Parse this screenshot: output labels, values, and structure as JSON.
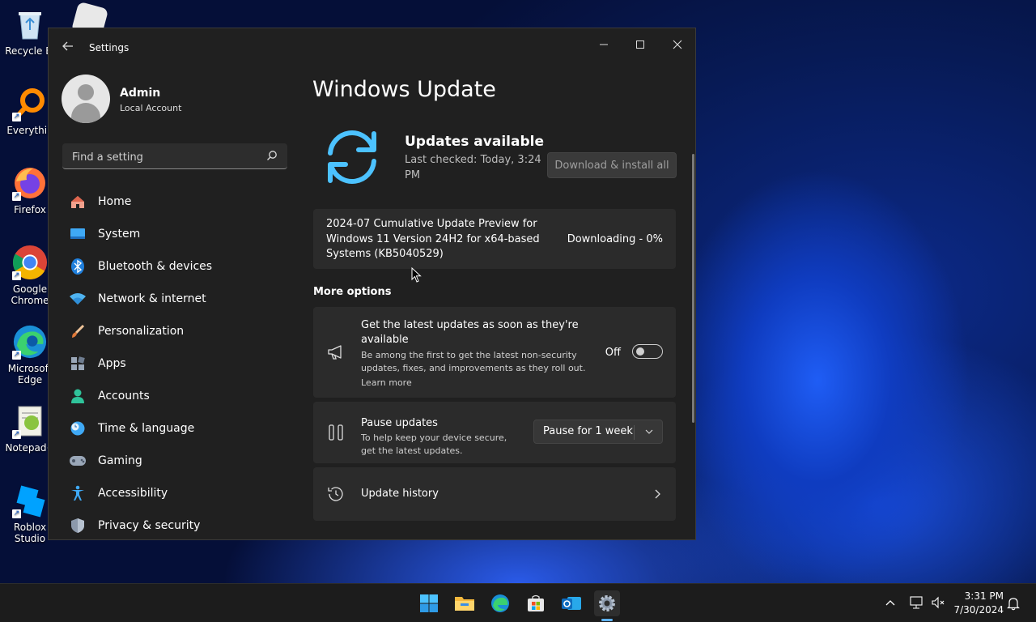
{
  "desktop": {
    "icons": [
      {
        "label": "Recycle Bi",
        "icon": "recycle-bin-icon"
      },
      {
        "label": "Everythin",
        "icon": "everything-search-icon"
      },
      {
        "label": "Firefox",
        "icon": "firefox-icon"
      },
      {
        "label": "Google Chrome",
        "icon": "chrome-icon"
      },
      {
        "label": "Microsoft Edge",
        "icon": "edge-icon"
      },
      {
        "label": "Notepad+",
        "icon": "notepad-plus-icon"
      },
      {
        "label": "Roblox Studio",
        "icon": "roblox-studio-icon"
      }
    ]
  },
  "window": {
    "title": "Settings",
    "controls": [
      "minimize",
      "maximize",
      "close"
    ]
  },
  "profile": {
    "name": "Admin",
    "account_type": "Local Account"
  },
  "search": {
    "placeholder": "Find a setting"
  },
  "nav": {
    "items": [
      {
        "label": "Home",
        "icon": "home-icon"
      },
      {
        "label": "System",
        "icon": "system-icon"
      },
      {
        "label": "Bluetooth & devices",
        "icon": "bluetooth-icon"
      },
      {
        "label": "Network & internet",
        "icon": "wifi-icon"
      },
      {
        "label": "Personalization",
        "icon": "brush-icon"
      },
      {
        "label": "Apps",
        "icon": "apps-icon"
      },
      {
        "label": "Accounts",
        "icon": "accounts-icon"
      },
      {
        "label": "Time & language",
        "icon": "globe-clock-icon"
      },
      {
        "label": "Gaming",
        "icon": "gamepad-icon"
      },
      {
        "label": "Accessibility",
        "icon": "accessibility-icon"
      },
      {
        "label": "Privacy & security",
        "icon": "shield-icon"
      }
    ]
  },
  "main": {
    "title": "Windows Update",
    "status": {
      "title": "Updates available",
      "last_checked": "Last checked: Today, 3:24 PM",
      "install_button": "Download & install all"
    },
    "update": {
      "name": "2024-07 Cumulative Update Preview for Windows 11 Version 24H2 for x64-based Systems (KB5040529)",
      "status": "Downloading - 0%"
    },
    "more_options_label": "More options",
    "latest_updates": {
      "title": "Get the latest updates as soon as they're available",
      "description": "Be among the first to get the latest non-security updates, fixes, and improvements as they roll out.",
      "learn_more": "Learn more",
      "toggle_label": "Off",
      "toggle_on": false
    },
    "pause": {
      "title": "Pause updates",
      "description": "To help keep your device secure, get the latest updates.",
      "dropdown_value": "Pause for 1 week"
    },
    "history": {
      "title": "Update history"
    }
  },
  "taskbar": {
    "apps": [
      "start-icon",
      "file-explorer-icon",
      "edge-icon",
      "store-icon",
      "outlook-icon",
      "settings-icon"
    ],
    "active_app": "settings-icon"
  },
  "tray": {
    "time": "3:31 PM",
    "date": "7/30/2024"
  },
  "colors": {
    "accent": "#4cc2ff",
    "window_bg": "#202020",
    "card_bg": "#2b2b2b",
    "link": "#99c9ff"
  }
}
